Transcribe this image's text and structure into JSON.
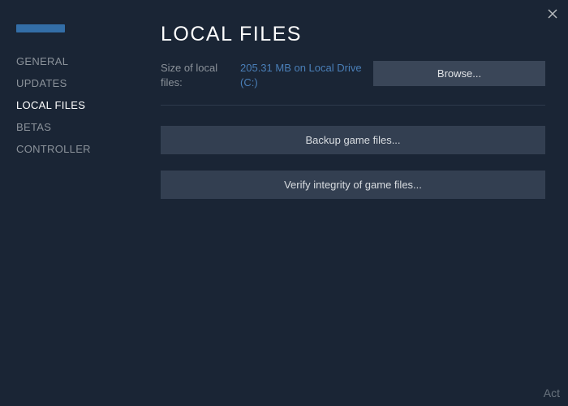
{
  "nav": {
    "general": "GENERAL",
    "updates": "UPDATES",
    "local_files": "LOCAL FILES",
    "betas": "BETAS",
    "controller": "CONTROLLER"
  },
  "page": {
    "title": "LOCAL FILES"
  },
  "size_info": {
    "label": "Size of local files:",
    "value": "205.31 MB on Local Drive (C:)"
  },
  "buttons": {
    "browse": "Browse...",
    "backup": "Backup game files...",
    "verify": "Verify integrity of game files..."
  },
  "watermark": "Act"
}
